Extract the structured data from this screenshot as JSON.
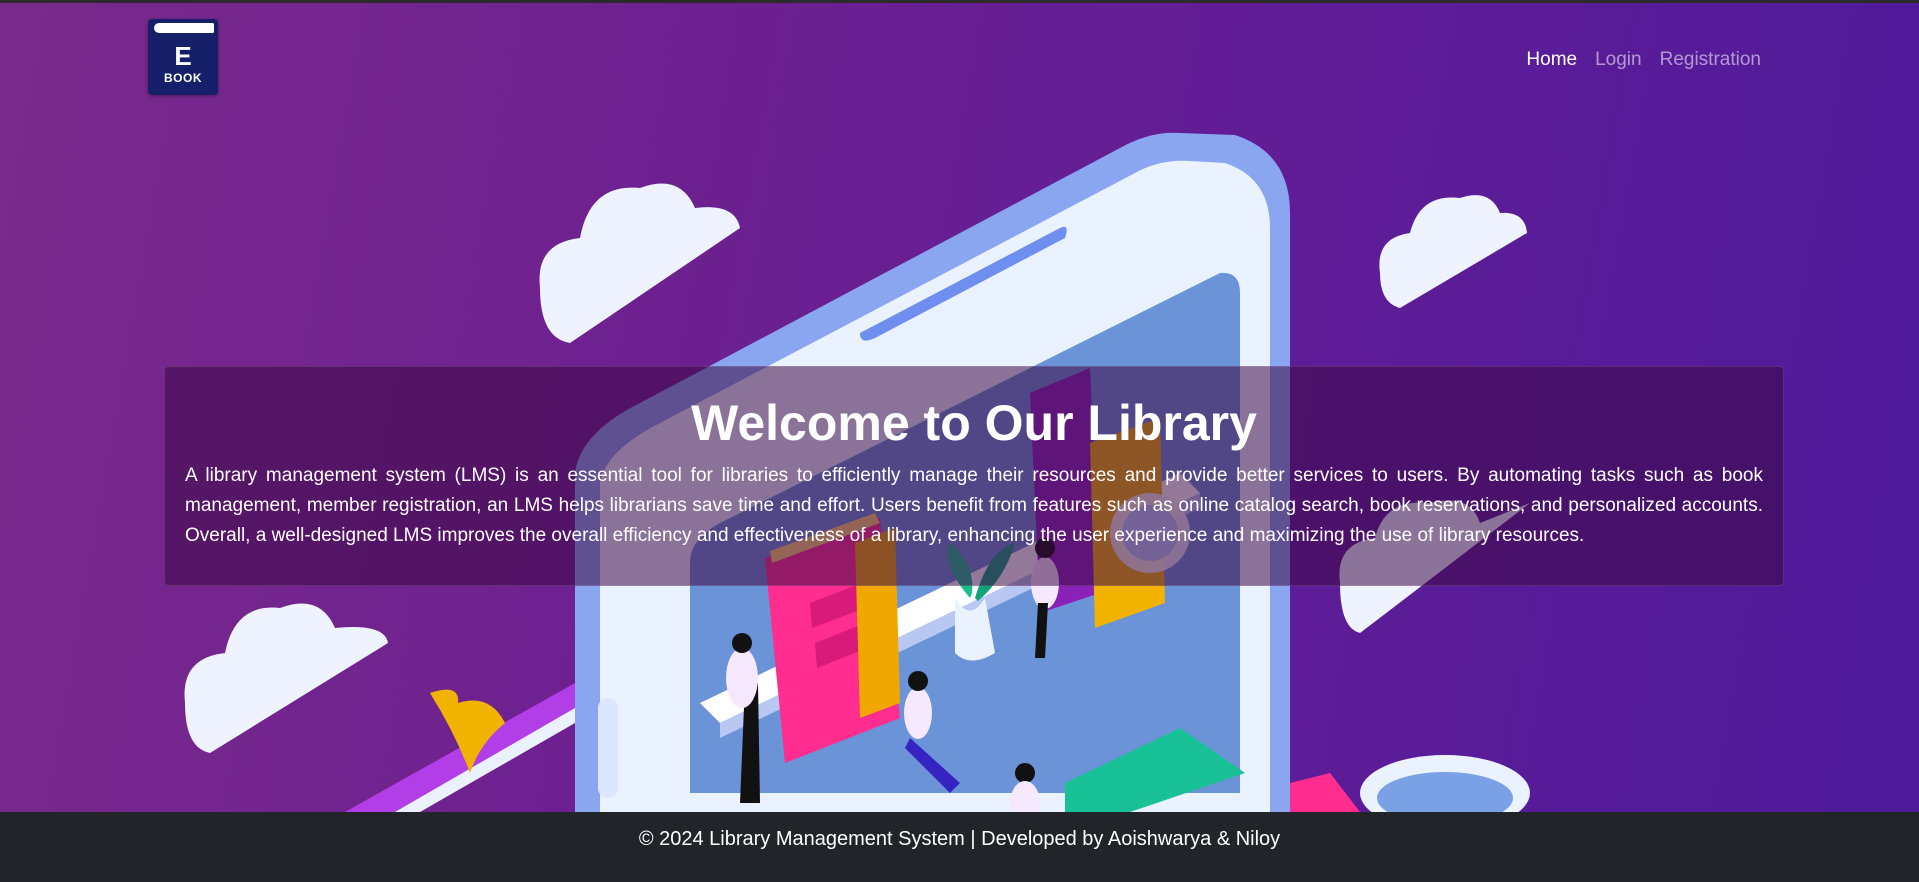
{
  "logo": {
    "letter": "E",
    "word": "BOOK"
  },
  "nav": {
    "home": "Home",
    "login": "Login",
    "registration": "Registration"
  },
  "hero": {
    "title": "Welcome to Our Library",
    "description": "A library management system (LMS) is an essential tool for libraries to efficiently manage their resources and provide better services to users. By automating tasks such as book management, member registration, an LMS helps librarians save time and effort. Users benefit from features such as online catalog search, book reservations, and personalized accounts. Overall, a well-designed LMS improves the overall efficiency and effectiveness of a library, enhancing the user experience and maximizing the use of library resources."
  },
  "footer": {
    "text": "© 2024 Library Management System | Developed by Aoishwarya & Niloy"
  },
  "colors": {
    "footer_bg": "#212529",
    "nav_active": "#ffffff",
    "hero_purple": "#6a1f92"
  }
}
